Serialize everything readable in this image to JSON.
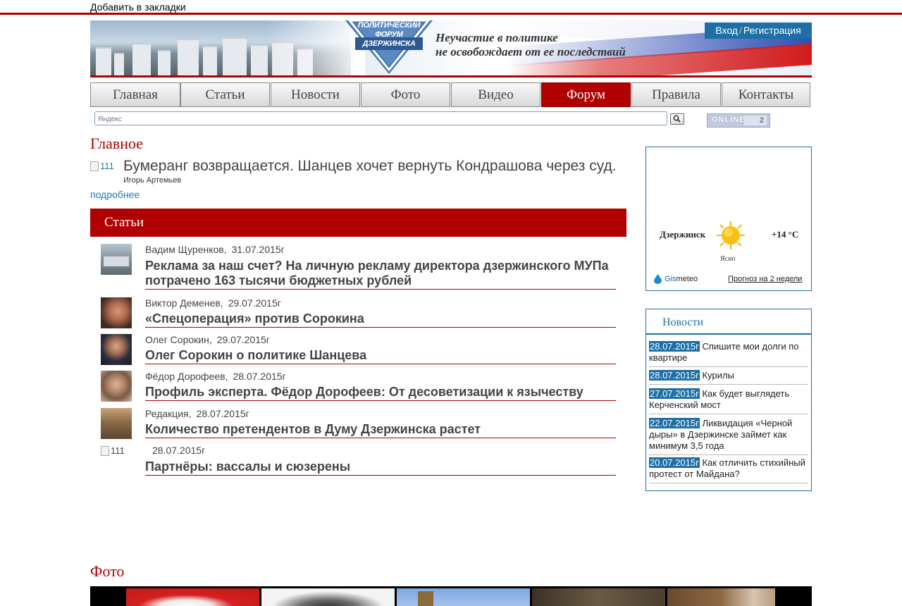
{
  "topbar": {
    "bookmark_label": "Добавить в закладки"
  },
  "header": {
    "logo_line1": "ПОЛИТИЧЕСКИЙ",
    "logo_line2": "ФОРУМ",
    "logo_line3": "ДЗЕРЖИНСКА",
    "slogan_line1": "Неучастие в политике",
    "slogan_line2": "не освобождает от ее последствий",
    "login_label": "Вход",
    "register_label": "Регистрация"
  },
  "nav": [
    {
      "label": "Главная",
      "active": false
    },
    {
      "label": "Статьи",
      "active": false
    },
    {
      "label": "Новости",
      "active": false
    },
    {
      "label": "Фото",
      "active": false
    },
    {
      "label": "Видео",
      "active": false
    },
    {
      "label": "Форум",
      "active": true
    },
    {
      "label": "Правила",
      "active": false
    },
    {
      "label": "Контакты",
      "active": false
    }
  ],
  "search": {
    "placeholder": "Яндекс"
  },
  "online": {
    "label": "ONLINE",
    "count": "2"
  },
  "main": {
    "heading": "Главное",
    "lead": {
      "image_alt": "111",
      "title": "Бумеранг возвращается. Шанцев хочет вернуть Кондрашова через суд.",
      "author": "Игорь Артемьев",
      "more_label": "подробнее"
    },
    "section_title": "Статьи",
    "articles": [
      {
        "author": "Вадим Щуренков,",
        "date": "31.07.2015г",
        "title": "Реклама за наш счет? На личную рекламу директора дзержинского МУПа потрачено 163 тысячи бюджетных рублей"
      },
      {
        "author": "Виктор Деменев,",
        "date": "29.07.2015г",
        "title": "«Спецоперация» против Сорокина"
      },
      {
        "author": "Олег Сорокин,",
        "date": "29.07.2015г",
        "title": "Олег Сорокин о политике Шанцева"
      },
      {
        "author": "Фёдор Дорофеев,",
        "date": "28.07.2015г",
        "title": "Профиль эксперта. Фёдор Дорофеев: От десоветизации к язычеству"
      },
      {
        "author": "Редакция,",
        "date": "28.07.2015г",
        "title": "Количество претендентов в Думу Дзержинска растет"
      },
      {
        "author": "",
        "date": "28.07.2015г",
        "title": "Партнёры: вассалы и сюзерены",
        "image_alt": "111"
      }
    ]
  },
  "weather": {
    "city": "Дзержинск",
    "temp": "+14 °C",
    "condition": "Ясно",
    "brand_g": "Gis",
    "brand_rest": "meteo",
    "forecast_link": "Прогноз на 2 недели"
  },
  "news": {
    "title": "Новости",
    "items": [
      {
        "date": "28.07.2015г",
        "text": "Спишите мои долги по квартире"
      },
      {
        "date": "28.07.2015г",
        "text": "Курилы"
      },
      {
        "date": "27.07.2015г",
        "text": "Как будет выглядеть Керченский мост"
      },
      {
        "date": "22.07.2015г",
        "text": "Ликвидация «Черной дыры» в Дзержинске займет как минимум 3,5 года"
      },
      {
        "date": "20.07.2015г",
        "text": "Как отличить стихийный протест от Майдана?"
      }
    ]
  },
  "photo": {
    "heading": "Фото"
  },
  "colors": {
    "accent_red": "#b00000",
    "accent_blue": "#1e6fa5",
    "title_red": "#aa0000"
  }
}
